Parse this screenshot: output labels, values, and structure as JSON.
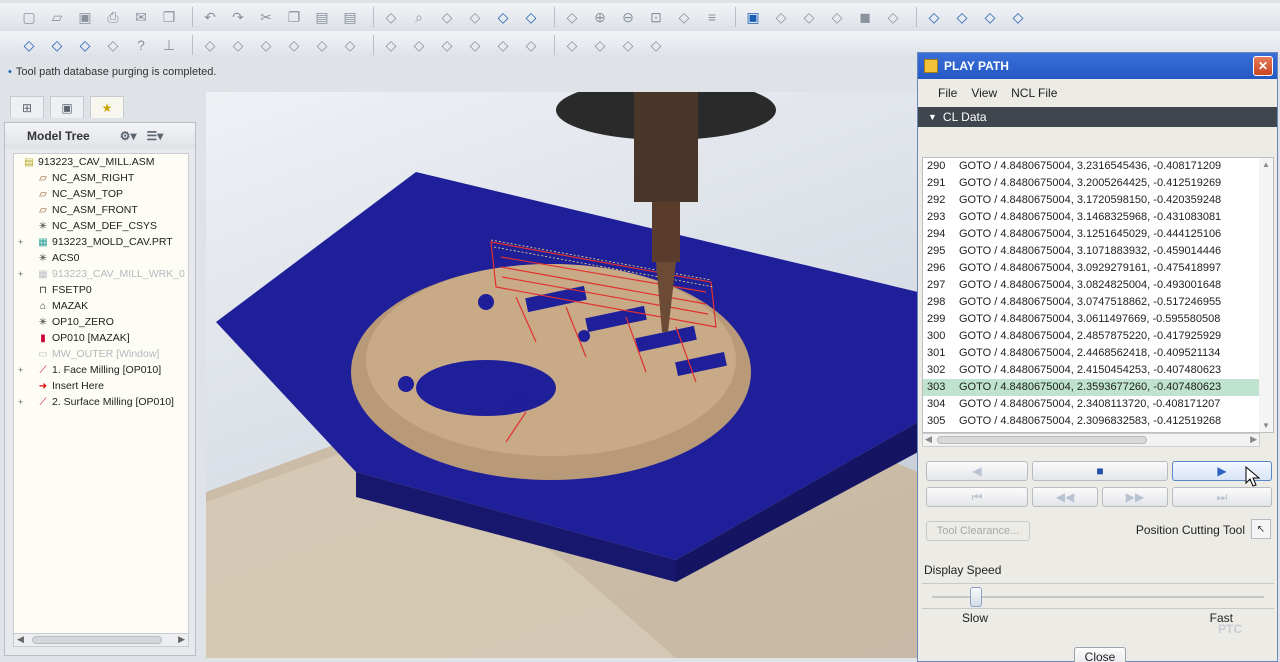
{
  "toolbar_row1_icons": [
    "new-icon",
    "open-icon",
    "save-icon",
    "print-icon",
    "send-icon",
    "copy-icon",
    "undo-icon",
    "redo-icon",
    "cut-icon",
    "copy-icon",
    "paste-icon",
    "paste-special-icon",
    "regenerate-icon",
    "find-icon",
    "select-box-icon",
    "repaint-icon",
    "datum-icon",
    "spin-center-icon",
    "orient-icon",
    "zoom-in-icon",
    "zoom-out-icon",
    "refit-icon",
    "view-manager-icon",
    "layers-icon",
    "saved-views-icon",
    "display-style-icon",
    "wireframe-icon",
    "hidden-line-icon",
    "shaded-icon",
    "enhanced-shading-icon",
    "datum-planes-icon",
    "datum-axes-icon",
    "datum-points-icon",
    "coordinate-systems-icon"
  ],
  "toolbar_row2_icons": [
    "mill-window-icon",
    "machining-icon",
    "mill-volume-icon",
    "material-removal-icon",
    "context-help-icon",
    "tool-path-icon",
    "toolpath-2-icon",
    "toolpath-3-icon",
    "toolpath-4-icon",
    "toolpath-5-icon",
    "toolpath-6-icon",
    "toolpath-7-icon",
    "toolpath-8-icon",
    "toolpath-9-icon",
    "toolpath-10-icon",
    "toolpath-11-icon",
    "toolpath-12-icon",
    "toolpath-13-icon",
    "toolpath-14-icon",
    "toolpath-15-icon",
    "toolpath-16-icon",
    "toolpath-17-icon"
  ],
  "status_message": "Tool path database purging is completed.",
  "model_tree": {
    "title": "Model Tree",
    "items": [
      {
        "label": "913223_CAV_MILL.ASM",
        "icon": "assembly-icon",
        "expand": "",
        "dim": false,
        "indent": 0
      },
      {
        "label": "NC_ASM_RIGHT",
        "icon": "datum-plane-icon",
        "expand": "",
        "dim": false,
        "indent": 1
      },
      {
        "label": "NC_ASM_TOP",
        "icon": "datum-plane-icon",
        "expand": "",
        "dim": false,
        "indent": 1
      },
      {
        "label": "NC_ASM_FRONT",
        "icon": "datum-plane-icon",
        "expand": "",
        "dim": false,
        "indent": 1
      },
      {
        "label": "NC_ASM_DEF_CSYS",
        "icon": "csys-icon",
        "expand": "",
        "dim": false,
        "indent": 1
      },
      {
        "label": "913223_MOLD_CAV.PRT",
        "icon": "part-icon",
        "expand": "+",
        "dim": false,
        "indent": 1
      },
      {
        "label": "ACS0",
        "icon": "csys-icon",
        "expand": "",
        "dim": false,
        "indent": 1
      },
      {
        "label": "913223_CAV_MILL_WRK_0",
        "icon": "workpiece-icon",
        "expand": "+",
        "dim": true,
        "indent": 1
      },
      {
        "label": "FSETP0",
        "icon": "fixture-icon",
        "expand": "",
        "dim": false,
        "indent": 1
      },
      {
        "label": "MAZAK",
        "icon": "machine-icon",
        "expand": "",
        "dim": false,
        "indent": 1
      },
      {
        "label": "OP10_ZERO",
        "icon": "csys-icon",
        "expand": "",
        "dim": false,
        "indent": 1
      },
      {
        "label": "OP010 [MAZAK]",
        "icon": "operation-icon",
        "expand": "",
        "dim": false,
        "indent": 1
      },
      {
        "label": "MW_OUTER [Window]",
        "icon": "window-icon",
        "expand": "",
        "dim": true,
        "indent": 1
      },
      {
        "label": "1. Face Milling [OP010]",
        "icon": "face-milling-icon",
        "expand": "+",
        "dim": false,
        "indent": 1
      },
      {
        "label": "Insert Here",
        "icon": "insert-here-icon",
        "expand": "",
        "dim": false,
        "indent": 1
      },
      {
        "label": "2. Surface Milling [OP010]",
        "icon": "surface-milling-icon",
        "expand": "+",
        "dim": false,
        "indent": 1
      }
    ]
  },
  "dialog": {
    "title": "PLAY PATH",
    "menus": [
      "File",
      "View",
      "NCL File"
    ],
    "section_label": "CL Data",
    "cl_rows": [
      {
        "line": "290",
        "cmd": "GOTO / 4.8480675004, 3.2316545436, -0.408171209"
      },
      {
        "line": "291",
        "cmd": "GOTO / 4.8480675004, 3.2005264425, -0.412519269"
      },
      {
        "line": "292",
        "cmd": "GOTO / 4.8480675004, 3.1720598150, -0.420359248"
      },
      {
        "line": "293",
        "cmd": "GOTO / 4.8480675004, 3.1468325968, -0.431083081"
      },
      {
        "line": "294",
        "cmd": "GOTO / 4.8480675004, 3.1251645029, -0.444125106"
      },
      {
        "line": "295",
        "cmd": "GOTO / 4.8480675004, 3.1071883932, -0.459014446"
      },
      {
        "line": "296",
        "cmd": "GOTO / 4.8480675004, 3.0929279161, -0.475418997"
      },
      {
        "line": "297",
        "cmd": "GOTO / 4.8480675004, 3.0824825004, -0.493001648"
      },
      {
        "line": "298",
        "cmd": "GOTO / 4.8480675004, 3.0747518862, -0.517246955"
      },
      {
        "line": "299",
        "cmd": "GOTO / 4.8480675004, 3.0611497669, -0.595580508"
      },
      {
        "line": "300",
        "cmd": "GOTO / 4.8480675004, 2.4857875220, -0.417925929"
      },
      {
        "line": "301",
        "cmd": "GOTO / 4.8480675004, 2.4468562418, -0.409521134"
      },
      {
        "line": "302",
        "cmd": "GOTO / 4.8480675004, 2.4150454253, -0.407480623"
      },
      {
        "line": "303",
        "cmd": "GOTO / 4.8480675004, 2.3593677260, -0.407480623"
      },
      {
        "line": "304",
        "cmd": "GOTO / 4.8480675004, 2.3408113720, -0.408171207"
      },
      {
        "line": "305",
        "cmd": "GOTO / 4.8480675004, 2.3096832583, -0.412519268"
      }
    ],
    "selected_line": "303",
    "tool_clearance_label": "Tool Clearance...",
    "position_cutting_tool_label": "Position Cutting Tool",
    "display_speed_label": "Display Speed",
    "display_speed_fraction": 0.12,
    "slow_label": "Slow",
    "fast_label": "Fast",
    "close_label": "Close"
  },
  "watermark": "PTC",
  "colors": {
    "title_bar": "#2459c4",
    "cl_header": "#3f464d",
    "selected_row": "#bfe3cf",
    "fixture_blue": "#1f1f9a",
    "part_bronze": "#b89a78",
    "toolpath_red": "#e03030"
  }
}
